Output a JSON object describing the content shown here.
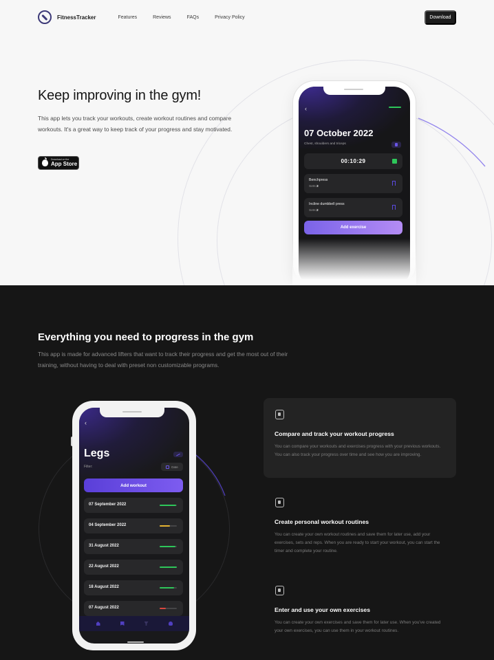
{
  "nav": {
    "brand": "FitnessTracker",
    "links": [
      "Features",
      "Reviews",
      "FAQs",
      "Privacy Policy"
    ],
    "download_label": "Download"
  },
  "hero": {
    "title": "Keep improving in the gym!",
    "description": "This app lets you track your workouts, create workout routines and compare workouts. It's a great way to keep track of your progress and stay motivated.",
    "appstore_small": "Download on the",
    "appstore_big": "App Store"
  },
  "hero_phone": {
    "date": "07 October 2022",
    "subtitle": "Chest, shoulders and triceps",
    "timer": "00:10:29",
    "exercises": [
      {
        "name": "Benchpress",
        "sets_label": "Sets:",
        "sets": "3"
      },
      {
        "name": "Incline dumbbell press",
        "sets_label": "Sets:",
        "sets": "2"
      }
    ],
    "add_label": "Add exercise"
  },
  "section": {
    "title": "Everything you need to progress in the gym",
    "description": "This app is made for advanced lifters that want to track their progress and get the most out of their training, without having to deal with preset non customizable programs."
  },
  "legs_phone": {
    "title": "Legs",
    "filter_label": "Filter:",
    "date_chip": "Date",
    "add_label": "Add workout",
    "workouts": [
      {
        "date": "07 September 2022",
        "progress": 0.95,
        "color": "#2ec75a"
      },
      {
        "date": "04 September 2022",
        "progress": 0.6,
        "color": "#e6b431"
      },
      {
        "date": "31 August 2022",
        "progress": 0.9,
        "color": "#2ec75a"
      },
      {
        "date": "22 August 2022",
        "progress": 1.0,
        "color": "#2ec75a"
      },
      {
        "date": "18 August 2022",
        "progress": 0.85,
        "color": "#2ec75a"
      },
      {
        "date": "07 August 2022",
        "progress": 0.35,
        "color": "#d9473f"
      }
    ]
  },
  "features": [
    {
      "icon": "phone-icon",
      "title": "Compare and track your workout progress",
      "description": "You can compare your workouts and exercises progress with your previous workouts. You can also track your progress over time and see how you are improving."
    },
    {
      "icon": "phone-icon",
      "title": "Create personal workout routines",
      "description": "You can create your own workout routines and save them for later use, add your exercises, sets and reps. When you are ready to start your workout, you can start the timer and complete your routine."
    },
    {
      "icon": "phone-icon",
      "title": "Enter and use your own exercises",
      "description": "You can create your own exercises and save them for later use. When you've created your own exercises, you can use them in your workout routines."
    }
  ],
  "colors": {
    "accent": "#6a56e8",
    "brand": "#3d3a78",
    "dark_bg": "#161616",
    "light_bg": "#f7f7f7"
  }
}
